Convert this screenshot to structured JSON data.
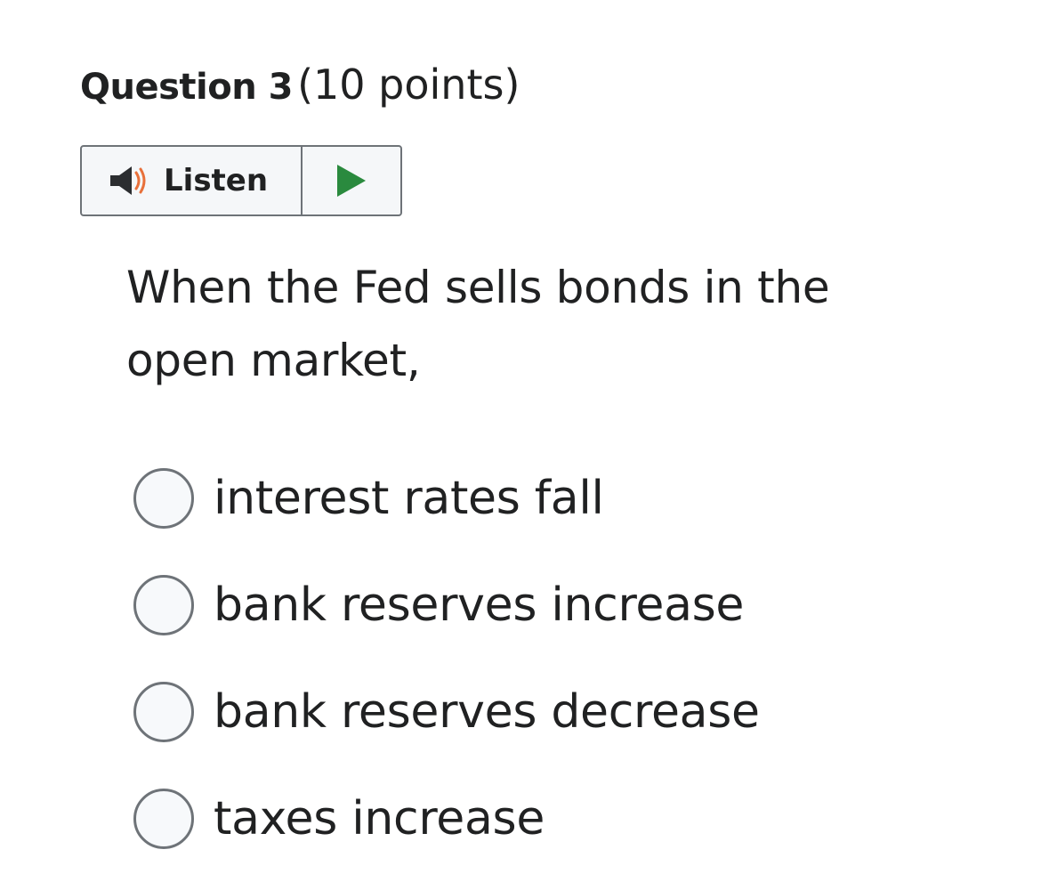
{
  "question": {
    "title": "Question 3",
    "points": "(10 points)",
    "text": "When the Fed sells bonds in the open market,"
  },
  "listen": {
    "label": "Listen",
    "speaker_icon": "speaker-icon",
    "play_icon": "play-icon",
    "colors": {
      "speaker_body": "#2b2d30",
      "speaker_waves": "#e8703a",
      "play": "#2a8a3e"
    }
  },
  "options": [
    {
      "label": "interest rates fall",
      "selected": false
    },
    {
      "label": "bank reserves increase",
      "selected": false
    },
    {
      "label": "bank reserves decrease",
      "selected": false
    },
    {
      "label": "taxes increase",
      "selected": false
    }
  ]
}
